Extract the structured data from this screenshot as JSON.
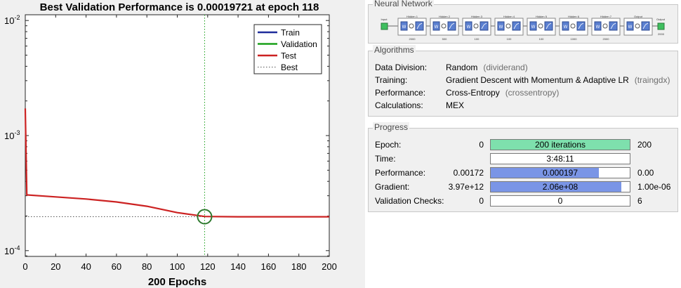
{
  "colors": {
    "train": "#1f2d9b",
    "validation": "#1aa01a",
    "test": "#cc2222",
    "best": "#2f7a2f",
    "fill_green": "#7ee0ad",
    "fill_blue": "#7a95e6"
  },
  "chart_data": {
    "type": "line",
    "title": "Best Validation Performance is 0.00019721 at epoch 118",
    "xlabel": "200 Epochs",
    "ylabel": "",
    "xlim": [
      0,
      200
    ],
    "ylim_log10": [
      -4.05,
      -1.95
    ],
    "yscale": "log",
    "xticks": [
      "0",
      "20",
      "40",
      "60",
      "80",
      "100",
      "120",
      "140",
      "160",
      "180",
      "200"
    ],
    "yticks": [
      {
        "label": "10",
        "exp": "-2",
        "value": 0.01
      },
      {
        "label": "10",
        "exp": "-3",
        "value": 0.001
      },
      {
        "label": "10",
        "exp": "-4",
        "value": 0.0001
      }
    ],
    "legend": {
      "placement": "top-right",
      "entries": [
        "Train",
        "Validation",
        "Test",
        "Best"
      ]
    },
    "best_epoch": 118,
    "best_value": 0.00019721,
    "series": [
      {
        "name": "Test",
        "x": [
          0,
          1,
          20,
          40,
          60,
          80,
          100,
          118,
          140,
          160,
          180,
          200
        ],
        "y": [
          0.00172,
          0.000305,
          0.000293,
          0.000281,
          0.000265,
          0.000243,
          0.000214,
          0.000198,
          0.000197,
          0.000197,
          0.000197,
          0.000197
        ]
      }
    ]
  },
  "nn": {
    "title": "Neural Network",
    "input_label": "Input",
    "output_label": "Output",
    "layers": [
      "Hidden 1",
      "Hidden 2",
      "Hidden 3",
      "Hidden 4",
      "Hidden 5",
      "Hidden 6",
      "Hidden 7",
      "Output"
    ],
    "sizes": [
      "2000",
      "500",
      "100",
      "100",
      "100",
      "1000",
      "2000",
      "",
      "2000"
    ]
  },
  "algorithms": {
    "title": "Algorithms",
    "rows": [
      {
        "label": "Data Division:",
        "value": "Random",
        "paren": "(dividerand)"
      },
      {
        "label": "Training:",
        "value": "Gradient Descent with Momentum & Adaptive LR",
        "paren": "(traingdx)"
      },
      {
        "label": "Performance:",
        "value": "Cross-Entropy",
        "paren": "(crossentropy)"
      },
      {
        "label": "Calculations:",
        "value": "MEX",
        "paren": ""
      }
    ]
  },
  "progress": {
    "title": "Progress",
    "rows": [
      {
        "label": "Epoch:",
        "start": "0",
        "bar_text": "200 iterations",
        "end": "200",
        "fill": 1.0,
        "color": "green"
      },
      {
        "label": "Time:",
        "start": "",
        "bar_text": "3:48:11",
        "end": "",
        "fill": 0,
        "color": "none"
      },
      {
        "label": "Performance:",
        "start": "0.00172",
        "bar_text": "0.000197",
        "end": "0.00",
        "fill": 0.78,
        "color": "blue"
      },
      {
        "label": "Gradient:",
        "start": "3.97e+12",
        "bar_text": "2.06e+08",
        "end": "1.00e-06",
        "fill": 0.94,
        "color": "blue"
      },
      {
        "label": "Validation Checks:",
        "start": "0",
        "bar_text": "0",
        "end": "6",
        "fill": 0,
        "color": "none"
      }
    ]
  }
}
